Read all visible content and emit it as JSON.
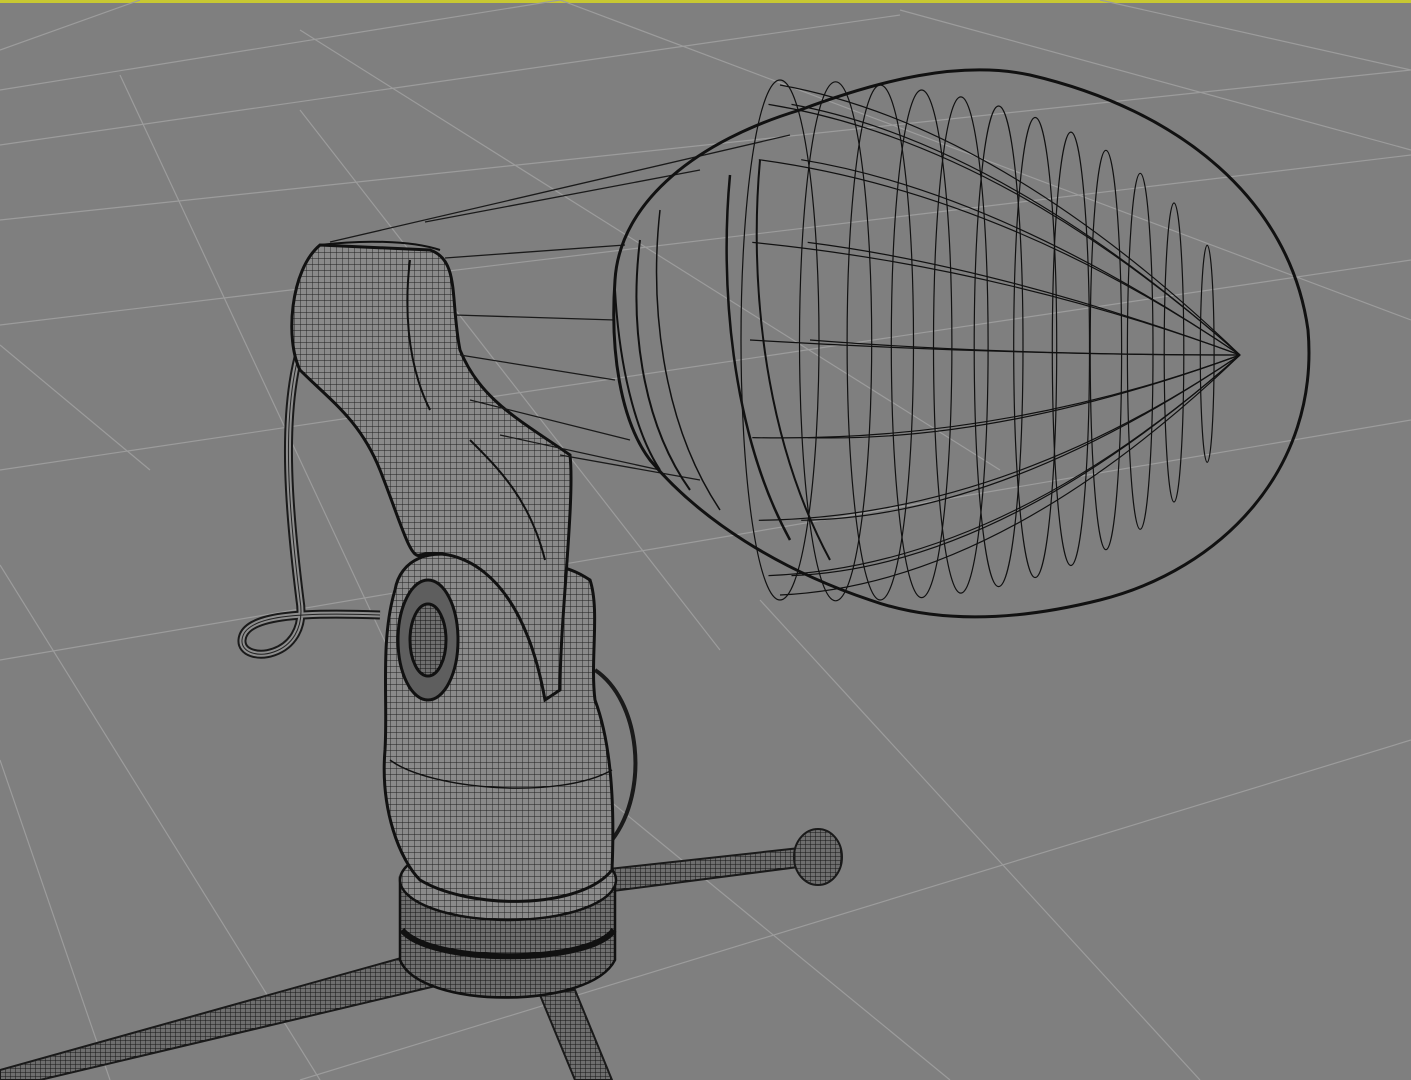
{
  "viewport": {
    "mode": "wireframe",
    "active_border_color": "#c8c832",
    "background_color": "#7f7f7f",
    "grid_color": "#9a9a9a",
    "wire_color": "#1a1a1a"
  },
  "scene": {
    "objects": [
      {
        "name": "microphone-head",
        "kind": "mesh"
      },
      {
        "name": "microphone-body",
        "kind": "mesh"
      },
      {
        "name": "stand-clip",
        "kind": "mesh"
      },
      {
        "name": "stand-collar",
        "kind": "mesh"
      },
      {
        "name": "tripod-legs",
        "kind": "mesh"
      },
      {
        "name": "cable",
        "kind": "mesh"
      }
    ]
  }
}
